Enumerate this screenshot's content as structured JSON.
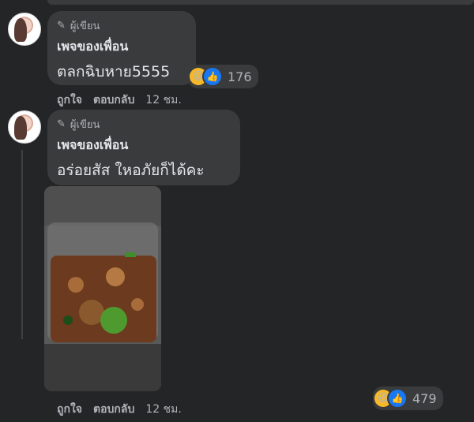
{
  "comments": [
    {
      "author_tag": "ผู้เขียน",
      "author": "เพจของเพื่อน",
      "text": "ตลกฉิบหาย5555",
      "reaction_count": "176",
      "actions": [
        "ถูกใจ",
        "ตอบกลับ",
        "12 ชม."
      ]
    },
    {
      "author_tag": "ผู้เขียน",
      "author": "เพจของเพื่อน",
      "text": "อร่อยสัส ใหอภัยก็ได้คะ",
      "reaction_count": "479",
      "actions": [
        "ถูกใจ",
        "ตอบกลับ",
        "12 ชม."
      ]
    }
  ],
  "icons": {
    "author_badge": "pencil-icon",
    "reaction_1": "laughing-emoji-icon",
    "reaction_2": "thumbs-up-icon"
  },
  "colors": {
    "background": "#242526",
    "bubble": "#3a3b3c",
    "like_blue": "#1877f2",
    "emoji_yellow": "#f7b928"
  }
}
